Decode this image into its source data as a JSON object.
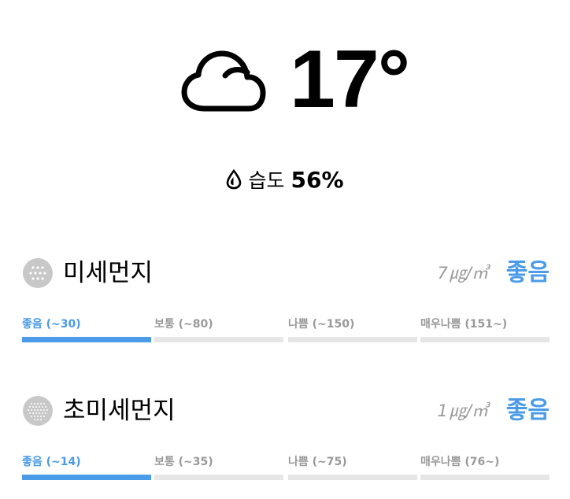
{
  "weather": {
    "icon": "cloud-icon",
    "temperature": "17°"
  },
  "humidity": {
    "icon": "droplet-icon",
    "label": "습도",
    "value": "56%"
  },
  "colors": {
    "accent": "#4a9be8",
    "muted": "#999999",
    "bar_inactive": "#e6e6e6"
  },
  "fine_dust": {
    "icon": "fine-dust-icon",
    "title": "미세먼지",
    "value": "7",
    "unit": "㎍/㎥",
    "grade": "좋음",
    "scale": [
      {
        "label": "좋음 (~30)",
        "active": true
      },
      {
        "label": "보통 (~80)",
        "active": false
      },
      {
        "label": "나쁨 (~150)",
        "active": false
      },
      {
        "label": "매우나쁨 (151~)",
        "active": false
      }
    ]
  },
  "ultra_fine_dust": {
    "icon": "ultra-fine-dust-icon",
    "title": "초미세먼지",
    "value": "1",
    "unit": "㎍/㎥",
    "grade": "좋음",
    "scale": [
      {
        "label": "좋음 (~14)",
        "active": true
      },
      {
        "label": "보통 (~35)",
        "active": false
      },
      {
        "label": "나쁨 (~75)",
        "active": false
      },
      {
        "label": "매우나쁨 (76~)",
        "active": false
      }
    ]
  }
}
